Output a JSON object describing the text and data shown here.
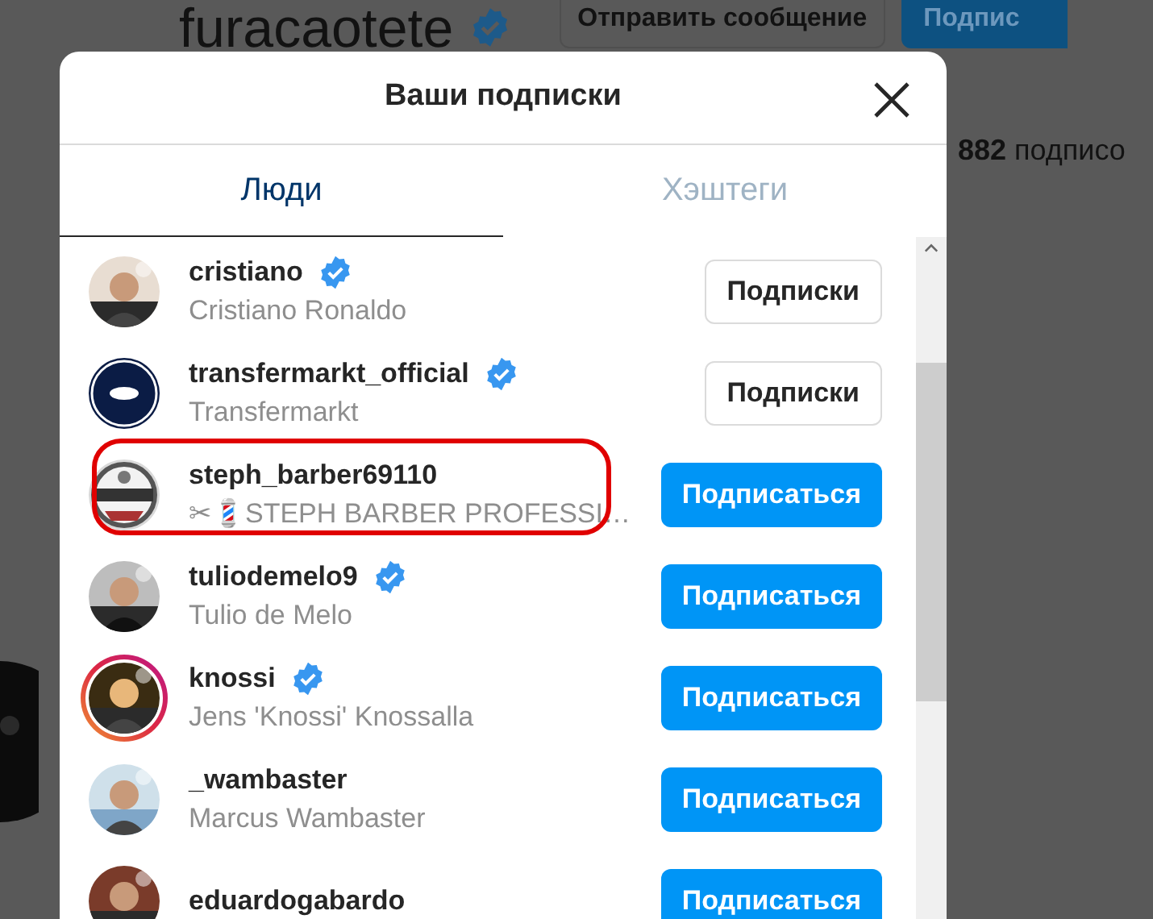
{
  "profile": {
    "username": "furacaotete",
    "verified": true,
    "message_button": "Отправить сообщение",
    "follow_button": "Подпис",
    "followers": "882",
    "followers_label": "подписо"
  },
  "dialog": {
    "title": "Ваши подписки",
    "tabs": [
      {
        "label": "Люди",
        "selected": true
      },
      {
        "label": "Хэштеги",
        "selected": false
      }
    ],
    "accounts": [
      {
        "username": "cristiano",
        "name": "Cristiano Ronaldo",
        "verified": true,
        "story": false,
        "highlighted": false,
        "following": true,
        "button": "Подписки"
      },
      {
        "username": "transfermarkt_official",
        "name": "Transfermarkt",
        "verified": true,
        "story": false,
        "highlighted": false,
        "following": true,
        "button": "Подписки",
        "kind": "logo"
      },
      {
        "username": "steph_barber69110",
        "name": "✂💈STEPH BARBER PROFESSI…",
        "verified": false,
        "story": false,
        "highlighted": true,
        "following": false,
        "button": "Подписаться",
        "kind": "badge"
      },
      {
        "username": "tuliodemelo9",
        "name": "Tulio de Melo",
        "verified": true,
        "story": false,
        "highlighted": false,
        "following": false,
        "button": "Подписаться"
      },
      {
        "username": "knossi",
        "name": "Jens 'Knossi' Knossalla",
        "verified": true,
        "story": true,
        "highlighted": false,
        "following": false,
        "button": "Подписаться"
      },
      {
        "username": "_wambaster",
        "name": "Marcus Wambaster",
        "verified": false,
        "story": false,
        "highlighted": false,
        "following": false,
        "button": "Подписаться"
      },
      {
        "username": "eduardogabardo",
        "verified": false,
        "story": false,
        "highlighted": false,
        "following": false,
        "button": "Подписаться"
      }
    ]
  }
}
